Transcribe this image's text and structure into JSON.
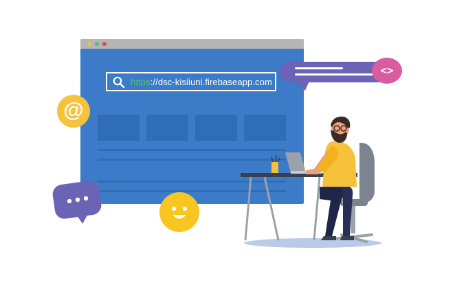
{
  "browser": {
    "address_bar": {
      "scheme": "https",
      "rest": "://dsc-kisiiuni.firebaseapp.com"
    },
    "window_dot_colors": [
      "#f2c23b",
      "#4ec36a",
      "#e04b3e"
    ],
    "search_icon": "search-icon"
  },
  "badges": {
    "email": "@",
    "code": "<>",
    "chat": "•••"
  },
  "icons": [
    "search-icon",
    "at-sign-icon",
    "code-brackets-icon",
    "chat-dots-icon",
    "smiley-icon"
  ],
  "colors": {
    "browser_blue": "#3b7bc8",
    "tile_blue": "#2f6db6",
    "purple": "#6b63b5",
    "pink": "#d95ba0",
    "yellow": "#f7c23b",
    "accent_green": "#4ec36a"
  }
}
